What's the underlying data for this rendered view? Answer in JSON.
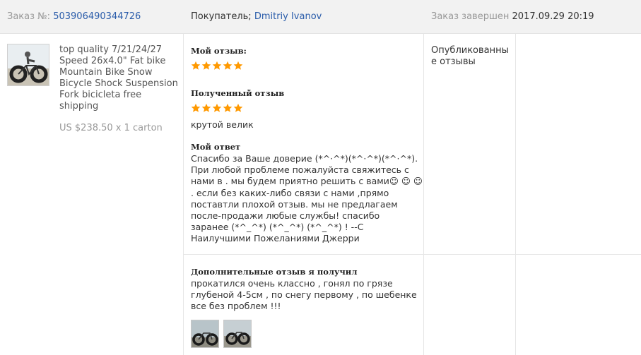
{
  "header": {
    "order_label": "Заказ №:",
    "order_number": "503906490344726",
    "buyer_label": "Покупатель;",
    "buyer_name": "Dmitriy Ivanov",
    "completed_label": "Заказ завершен",
    "completed_date": "2017.09.29 20:19"
  },
  "product": {
    "image_icon": "fat-bike-photo",
    "title": "top quality 7/21/24/27 Speed 26x4.0\" Fat bike Mountain Bike Snow Bicycle Shock Suspension Fork bicicleta free shipping",
    "price": "US $238.50 x 1 carton"
  },
  "feedback": {
    "my_review_label": "Мой отзыв:",
    "my_rating": 5,
    "received_label": "Полученный отзыв",
    "received_rating": 5,
    "received_text": "крутой велик",
    "reply_label": "Мой ответ",
    "reply_lines": [
      "Спасибо за Ваше доверие (*^·^*)(*^·^*)(*^·^*).",
      "При любой проблеме пожалуйста свяжитесь с",
      "нами в . мы будем приятно решить с вами☺ ☺ ☺",
      ". если без каких-либо связи с нами ,прямо",
      "поставтли плохой отзыв. мы не предлагаем",
      "после-продажи любые службы! спасибо",
      "заранее (*^_^*) (*^_^*) (*^_^*) ! --С",
      "Наилучшими Пожеланиями Джерри"
    ],
    "additional_label": "Дополнительные отзыв я получил",
    "additional_lines": [
      "прокатился очень классно , гонял по грязе",
      "глубеной 4-5см , по снегу первому , по шебенке",
      "все без проблем !!!"
    ],
    "photos": [
      "bike-photo-1",
      "bike-photo-2"
    ]
  },
  "status": {
    "text_line1": "Опубликованны",
    "text_line2": "е отзывы"
  },
  "colors": {
    "header_bg": "#f2f2f2",
    "link": "#2a5caa",
    "star": "#ff9900",
    "muted": "#999999"
  }
}
